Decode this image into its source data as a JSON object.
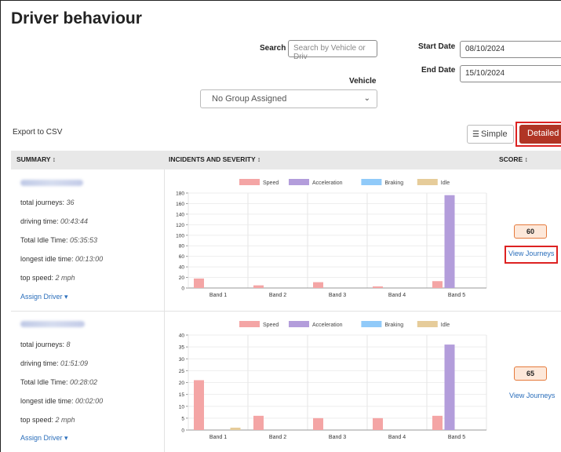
{
  "page": {
    "title": "Driver behaviour"
  },
  "filters": {
    "search_label": "Search",
    "search_placeholder": "Search by Vehicle or Driv",
    "start_date_label": "Start Date",
    "start_date_value": "08/10/2024",
    "end_date_label": "End Date",
    "end_date_value": "15/10/2024",
    "vehicle_label": "Vehicle",
    "vehicle_selected": "No Group Assigned"
  },
  "toolbar": {
    "export_label": "Export to CSV",
    "simple_label": "Simple",
    "detailed_label": "Detailed"
  },
  "table": {
    "headers": {
      "summary": "SUMMARY ↕",
      "incidents": "INCIDENTS AND SEVERITY ↕",
      "score": "SCORE ↕"
    },
    "legend": [
      "Speed",
      "Acceleration",
      "Braking",
      "Idle"
    ],
    "colors": {
      "Speed": "#f4a5a5",
      "Acceleration": "#b39ddb",
      "Braking": "#90caf9",
      "Idle": "#e6cc9a"
    },
    "rows": [
      {
        "journeys_label": "total journeys: ",
        "journeys_value": "36",
        "driving_label": "driving time: ",
        "driving_value": "00:43:44",
        "idle_label": "Total Idle Time: ",
        "idle_value": "05:35:53",
        "longest_label": "longest idle time: ",
        "longest_value": "00:13:00",
        "speed_label": "top speed: ",
        "speed_value": "2 mph",
        "assign_label": "Assign Driver ▾",
        "score": "60",
        "view_label": "View Journeys"
      },
      {
        "journeys_label": "total journeys: ",
        "journeys_value": "8",
        "driving_label": "driving time: ",
        "driving_value": "01:51:09",
        "idle_label": "Total Idle Time: ",
        "idle_value": "00:28:02",
        "longest_label": "longest idle time: ",
        "longest_value": "00:02:00",
        "speed_label": "top speed: ",
        "speed_value": "2 mph",
        "assign_label": "Assign Driver ▾",
        "score": "65",
        "view_label": "View Journeys"
      }
    ]
  },
  "chart_data": [
    {
      "type": "bar",
      "categories": [
        "Band 1",
        "Band 2",
        "Band 3",
        "Band 4",
        "Band 5"
      ],
      "series": [
        {
          "name": "Speed",
          "values": [
            18,
            5,
            11,
            3,
            13
          ]
        },
        {
          "name": "Acceleration",
          "values": [
            0,
            0,
            0,
            0,
            176
          ]
        },
        {
          "name": "Braking",
          "values": [
            0,
            0,
            0,
            0,
            0
          ]
        },
        {
          "name": "Idle",
          "values": [
            0,
            0,
            0,
            0,
            0
          ]
        }
      ],
      "ylim": [
        0,
        180
      ],
      "yticks": [
        0,
        20,
        40,
        60,
        80,
        100,
        120,
        140,
        160,
        180
      ],
      "legend": "top"
    },
    {
      "type": "bar",
      "categories": [
        "Band 1",
        "Band 2",
        "Band 3",
        "Band 4",
        "Band 5"
      ],
      "series": [
        {
          "name": "Speed",
          "values": [
            21,
            6,
            5,
            5,
            6
          ]
        },
        {
          "name": "Acceleration",
          "values": [
            0,
            0,
            0,
            0,
            36
          ]
        },
        {
          "name": "Braking",
          "values": [
            0,
            0,
            0,
            0,
            0
          ]
        },
        {
          "name": "Idle",
          "values": [
            1,
            0,
            0,
            0,
            0
          ]
        }
      ],
      "ylim": [
        0,
        40
      ],
      "yticks": [
        0,
        5,
        10,
        15,
        20,
        25,
        30,
        35,
        40
      ],
      "legend": "top"
    }
  ]
}
